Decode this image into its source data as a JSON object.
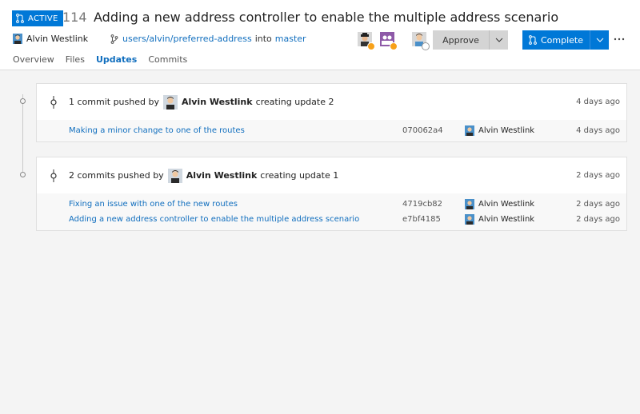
{
  "header": {
    "status": "ACTIVE",
    "pr_id": "114",
    "title": "Adding a new address controller to enable the multiple address scenario",
    "author": "Alvin Westlink",
    "source_branch": "users/alvin/preferred-address",
    "into_text": "into",
    "target_branch": "master",
    "approve_label": "Approve",
    "complete_label": "Complete"
  },
  "tabs": [
    "Overview",
    "Files",
    "Updates",
    "Commits"
  ],
  "active_tab": "Updates",
  "updates": [
    {
      "count_text": "1 commit pushed by",
      "author": "Alvin Westlink",
      "suffix": "creating update 2",
      "time": "4 days ago",
      "commits": [
        {
          "message": "Making a minor change to one of the routes",
          "hash": "070062a4",
          "author": "Alvin Westlink",
          "time": "4 days ago"
        }
      ]
    },
    {
      "count_text": "2 commits pushed by",
      "author": "Alvin Westlink",
      "suffix": "creating update 1",
      "time": "2 days ago",
      "commits": [
        {
          "message": "Fixing an issue with one of the new routes",
          "hash": "4719cb82",
          "author": "Alvin Westlink",
          "time": "2 days ago"
        },
        {
          "message": "Adding a new address controller to enable the multiple address scenario",
          "hash": "e7bf4185",
          "author": "Alvin Westlink",
          "time": "2 days ago"
        }
      ]
    }
  ],
  "colors": {
    "accent": "#0078d7",
    "link": "#106ebe",
    "pending": "#f7a11a"
  }
}
